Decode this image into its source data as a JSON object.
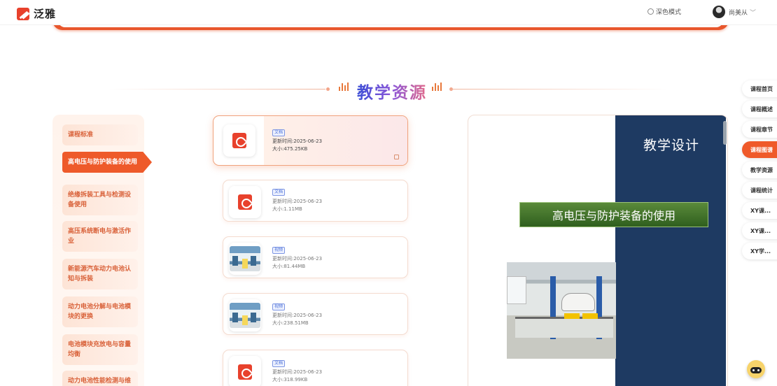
{
  "header": {
    "logo_text": "泛雅",
    "dark_mode_label": "深色模式",
    "user_name": "尚美从"
  },
  "section": {
    "title": "教学资源"
  },
  "chapters": [
    {
      "label": "课程标准",
      "active": false
    },
    {
      "label": "高电压与防护装备的使用",
      "active": true
    },
    {
      "label": "绝缘拆装工具与检测设备使用",
      "active": false
    },
    {
      "label": "高压系统断电与激活作业",
      "active": false
    },
    {
      "label": "新能源汽车动力电池认知与拆装",
      "active": false
    },
    {
      "label": "动力电池分解与电池模块的更换",
      "active": false
    },
    {
      "label": "电池模块充放电与容量均衡",
      "active": false
    },
    {
      "label": "动力电池性能检测与维",
      "active": false
    }
  ],
  "files": [
    {
      "type_badge": "文档",
      "kind": "pdf",
      "updated": "更新时间:2025-06-23",
      "size": "大小:475.25KB",
      "active": true
    },
    {
      "type_badge": "文档",
      "kind": "pdf",
      "updated": "更新时间:2025-06-23",
      "size": "大小:1.11MB",
      "active": false
    },
    {
      "type_badge": "视频",
      "kind": "video",
      "updated": "更新时间:2025-06-23",
      "size": "大小:81.44MB",
      "active": false
    },
    {
      "type_badge": "视频",
      "kind": "video",
      "updated": "更新时间:2025-06-23",
      "size": "大小:238.51MB",
      "active": false
    },
    {
      "type_badge": "文档",
      "kind": "pdf",
      "updated": "更新时间:2025-06-23",
      "size": "大小:318.99KB",
      "active": false
    }
  ],
  "preview": {
    "heading": "教学设计",
    "subtitle": "高电压与防护装备的使用"
  },
  "right_nav": [
    {
      "label": "课程首页",
      "active": false
    },
    {
      "label": "课程概述",
      "active": false
    },
    {
      "label": "课程章节",
      "active": false
    },
    {
      "label": "课程图谱",
      "active": true
    },
    {
      "label": "教学资源",
      "active": false
    },
    {
      "label": "课程统计",
      "active": false
    },
    {
      "label": "XY课...",
      "active": false
    },
    {
      "label": "XY课...",
      "active": false
    },
    {
      "label": "XY学...",
      "active": false
    }
  ],
  "colors": {
    "accent": "#ef5a2a",
    "navy": "#1e3a62",
    "badge_blue": "#4a6fd8"
  }
}
